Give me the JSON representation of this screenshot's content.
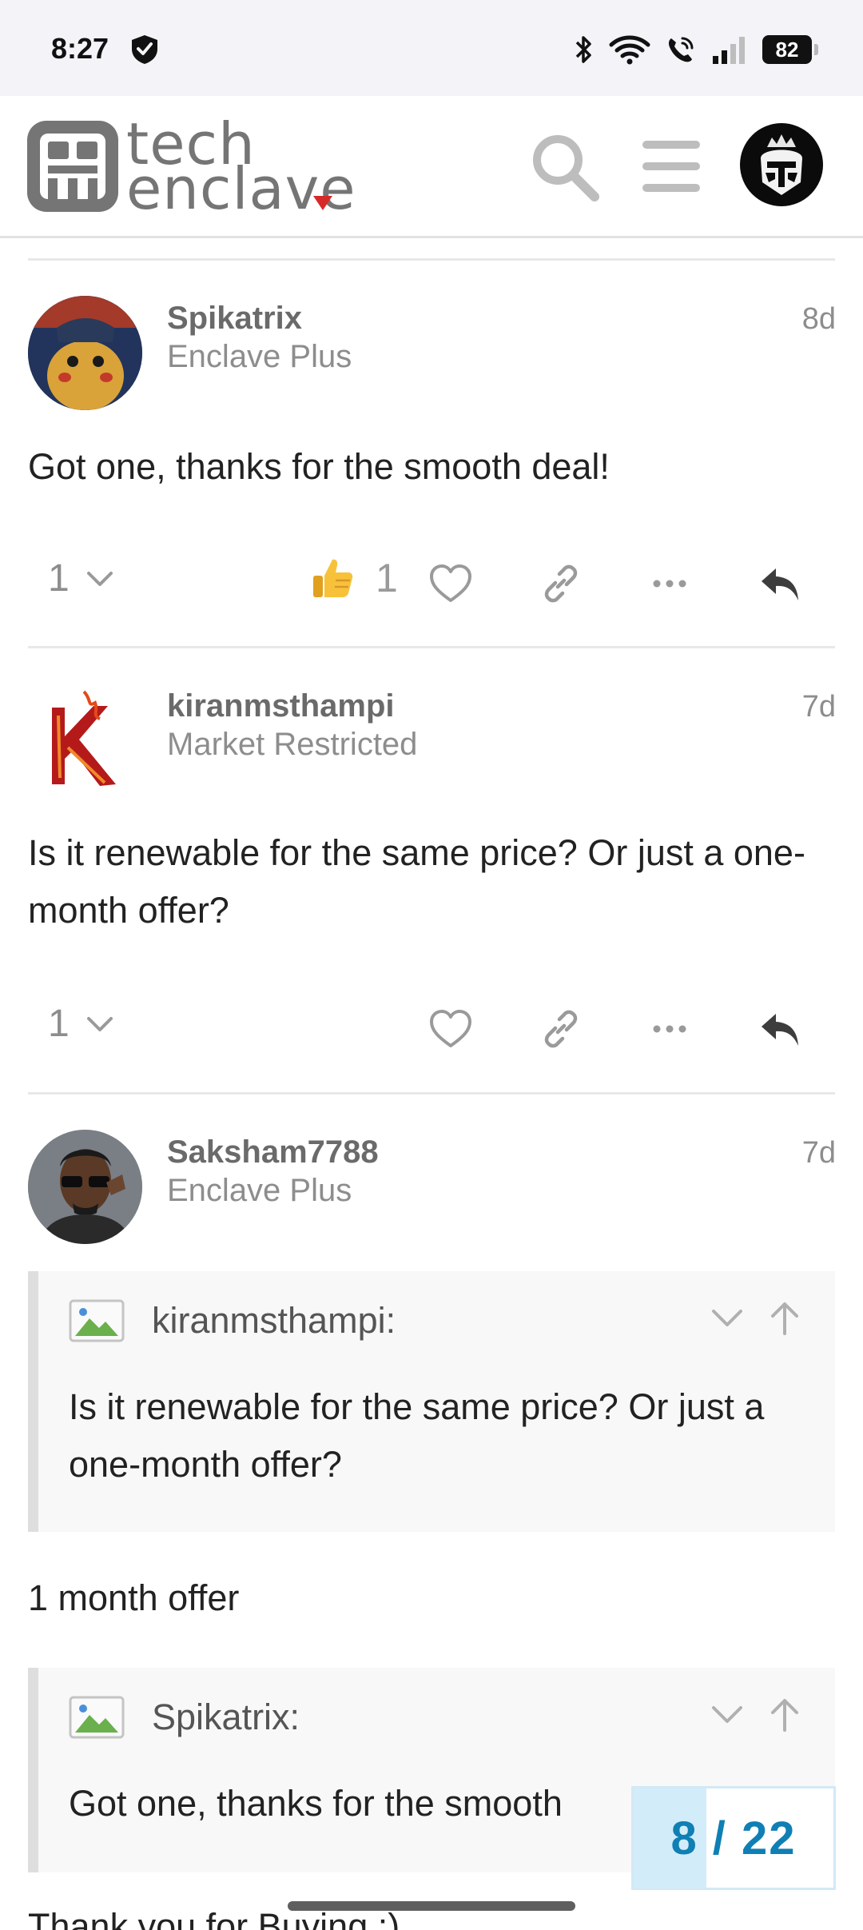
{
  "status_bar": {
    "time": "8:27",
    "battery": "82"
  },
  "header": {
    "logo_line1": "tech",
    "logo_line2": "enclave",
    "accent_color": "#d62a2a",
    "icons": [
      "search-icon",
      "hamburger-menu-icon",
      "user-avatar"
    ]
  },
  "posts": [
    {
      "username": "Spikatrix",
      "title": "Enclave Plus",
      "date": "8d",
      "body": "Got one, thanks for the smooth deal!",
      "replies": "1",
      "reaction_count": "1"
    },
    {
      "username": "kiranmsthampi",
      "title": "Market Restricted",
      "date": "7d",
      "body": "Is it renewable for the same price? Or just a one-month offer?",
      "replies": "1"
    },
    {
      "username": "Saksham7788",
      "title": "Enclave Plus",
      "date": "7d",
      "quote1_user": "kiranmsthampi:",
      "quote1_text": "Is it renewable for the same price? Or just a one-month offer?",
      "reply1": "1 month offer",
      "quote2_user": "Spikatrix:",
      "quote2_text": "Got one, thanks for the smooth",
      "reply2_partial": "Thank you for Buying :)"
    }
  ],
  "progress": {
    "current": "8",
    "separator": "/",
    "total": "22",
    "label": "8 / 22",
    "fraction": 0.364
  }
}
